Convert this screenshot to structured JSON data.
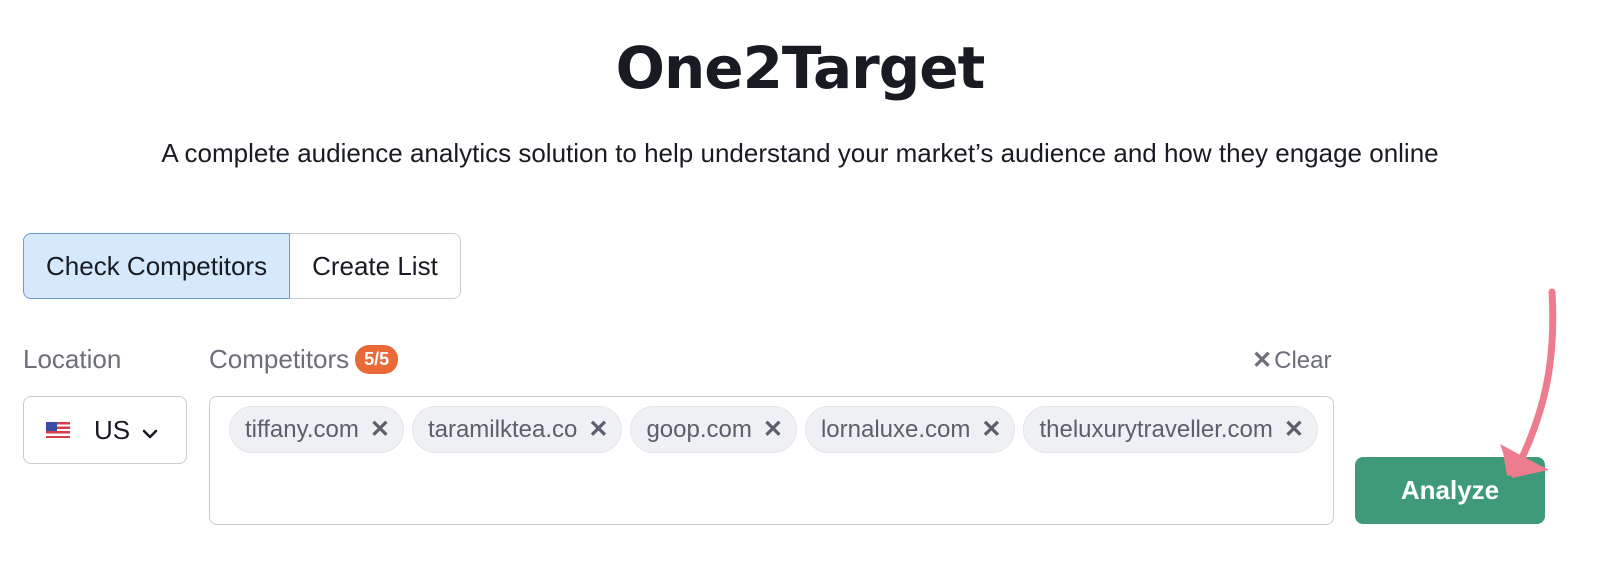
{
  "header": {
    "title": "One2Target",
    "subtitle": "A complete audience analytics solution to help understand your market’s audience and how they engage online"
  },
  "tabs": [
    {
      "label": "Check Competitors",
      "active": true
    },
    {
      "label": "Create List",
      "active": false
    }
  ],
  "location": {
    "label": "Location",
    "selected": "US",
    "flag_icon": "us-flag-icon"
  },
  "competitors": {
    "label": "Competitors",
    "count_badge": "5/5",
    "clear_label": "Clear",
    "chips": [
      {
        "domain": "tiffany.com"
      },
      {
        "domain": "taramilktea.co"
      },
      {
        "domain": "goop.com"
      },
      {
        "domain": "lornaluxe.com"
      },
      {
        "domain": "theluxurytraveller.com"
      }
    ]
  },
  "actions": {
    "analyze_label": "Analyze"
  },
  "annotation": {
    "arrow_color": "#ee7c8f"
  },
  "colors": {
    "accent_green": "#3f9a7a",
    "badge_orange": "#e96a36",
    "active_tab_bg": "#d6e8fc"
  }
}
